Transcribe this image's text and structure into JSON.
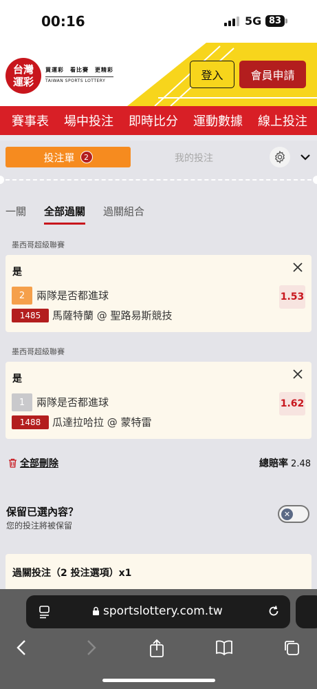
{
  "status_bar": {
    "time": "00:16",
    "network": "5G",
    "battery": "83"
  },
  "header": {
    "logo_line1": "台灣",
    "logo_line2": "運彩",
    "slogan": "買運彩　看比賽　更精彩",
    "english": "TAIWAN SPORTS LOTTERY",
    "login_label": "登入",
    "register_label": "會員申請"
  },
  "nav": {
    "items": [
      "賽事表",
      "場中投注",
      "即時比分",
      "運動數據",
      "線上投注"
    ]
  },
  "slip": {
    "tab_betslip": "投注單",
    "betslip_count": "2",
    "tab_mybets": "我的投注",
    "sub_tabs": [
      "一關",
      "全部過關",
      "過關組合"
    ],
    "selections": [
      {
        "league": "墨西哥超級聯賽",
        "pick": "是",
        "number": "2",
        "market": "兩隊是否都進球",
        "code": "1485",
        "match": "馬薩特蘭 @ 聖路易斯競技",
        "odds": "1.53"
      },
      {
        "league": "墨西哥超級聯賽",
        "pick": "是",
        "number": "1",
        "market": "兩隊是否都進球",
        "code": "1488",
        "match": "瓜達拉哈拉 @ 蒙特雷",
        "odds": "1.62"
      }
    ],
    "delete_all": "全部刪除",
    "total_odds_label": "總賠率",
    "total_odds_value": "2.48",
    "keep_title": "保留已選內容？",
    "keep_sub": "您的投注將被保留",
    "parlay_label": "過關投注（2 投注選項）x1"
  },
  "browser": {
    "url": "sportslottery.com.tw"
  },
  "colors": {
    "brand_red": "#d81f26",
    "accent_orange": "#f68b1f",
    "yellow": "#f7d51c",
    "odds_red": "#c8161d"
  }
}
